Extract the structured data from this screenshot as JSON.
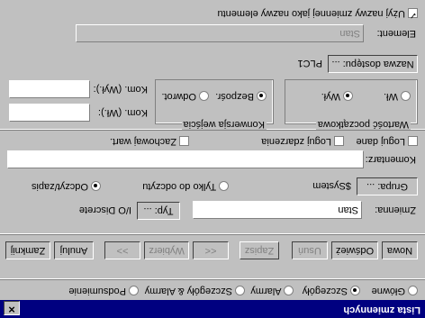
{
  "window": {
    "title": "Lista zmiennych",
    "close_label": "✕"
  },
  "view_options": [
    {
      "label": "Główne",
      "selected": false
    },
    {
      "label": "Szczegóły",
      "selected": true
    },
    {
      "label": "Alarmy",
      "selected": false
    },
    {
      "label": "Szczegóły & Alarmy",
      "selected": false
    },
    {
      "label": "Podsumienie",
      "selected": false
    }
  ],
  "toolbar": {
    "new_label": "Nowa",
    "refresh_label": "Odśwież",
    "delete_label": "Usuń",
    "save_label": "Zapisz",
    "prev_label": "<<",
    "select_label": "Wybierz",
    "next_label": ">>",
    "cancel_label": "Anuluj",
    "close_label": "Zamknij"
  },
  "variable": {
    "label": "Zmienna:",
    "value": "Stan",
    "type_button": "Typ: ...",
    "type_value": "I/O Discrete"
  },
  "group": {
    "button": "Grupa: ...",
    "value": "$System"
  },
  "access": {
    "read_only_label": "Tylko do odczytu",
    "read_write_label": "Odczyt/zapis",
    "read_write_selected": true
  },
  "comment": {
    "label": "Komentarz:",
    "value": ""
  },
  "options": {
    "log_data": "Loguj dane",
    "log_events": "Loguj zdarzenia",
    "retain_value": "Zachowaj wart."
  },
  "initial_value": {
    "title": "Wartość początkowa",
    "on": "Wł.",
    "off": "Wył.",
    "selected": "Wył."
  },
  "input_conversion": {
    "title": "Konwersja wejścia",
    "direct": "Bezpośr.",
    "inverse": "Odwrot.",
    "selected": "Bezpośr."
  },
  "messages": {
    "on_label": "Kom. (Wł.):",
    "on_value": "",
    "off_label": "Kom. (Wył.):",
    "off_value": ""
  },
  "access_name": {
    "button": "Nazwa dostępu: ...",
    "value": "PLC1"
  },
  "element": {
    "label": "Element:",
    "value": "Stan"
  },
  "use_name_as_element": {
    "label": "Użyj nazwy zmiennej jako nazwy elementu",
    "checked": true
  }
}
